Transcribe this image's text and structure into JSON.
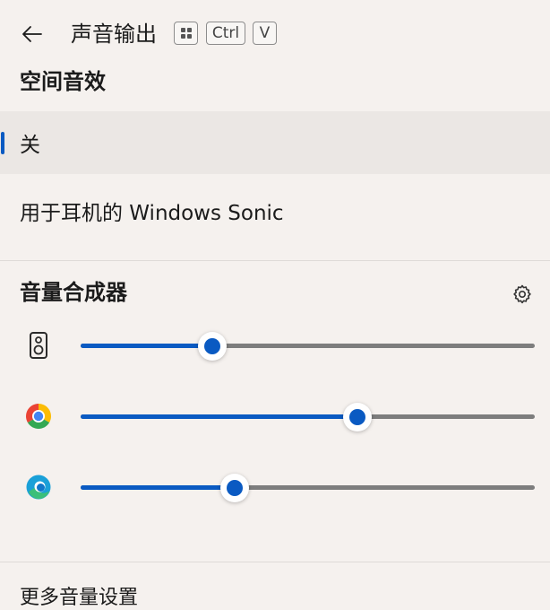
{
  "header": {
    "title": "声音输出",
    "shortcut_keys": [
      "win-key",
      "Ctrl",
      "V"
    ]
  },
  "spatial": {
    "title": "空间音效",
    "options": [
      {
        "label": "关",
        "selected": true
      },
      {
        "label": "用于耳机的 Windows Sonic",
        "selected": false
      }
    ]
  },
  "mixer": {
    "title": "音量合成器",
    "apps": [
      {
        "icon": "speaker-icon",
        "level_percent": 29
      },
      {
        "icon": "chrome-icon",
        "level_percent": 61
      },
      {
        "icon": "edge-icon",
        "level_percent": 34
      }
    ]
  },
  "footer": {
    "label": "更多音量设置"
  },
  "colors": {
    "accent": "#0a5ac2",
    "background": "#f5f1ee",
    "selected_row": "#ebe7e4"
  }
}
